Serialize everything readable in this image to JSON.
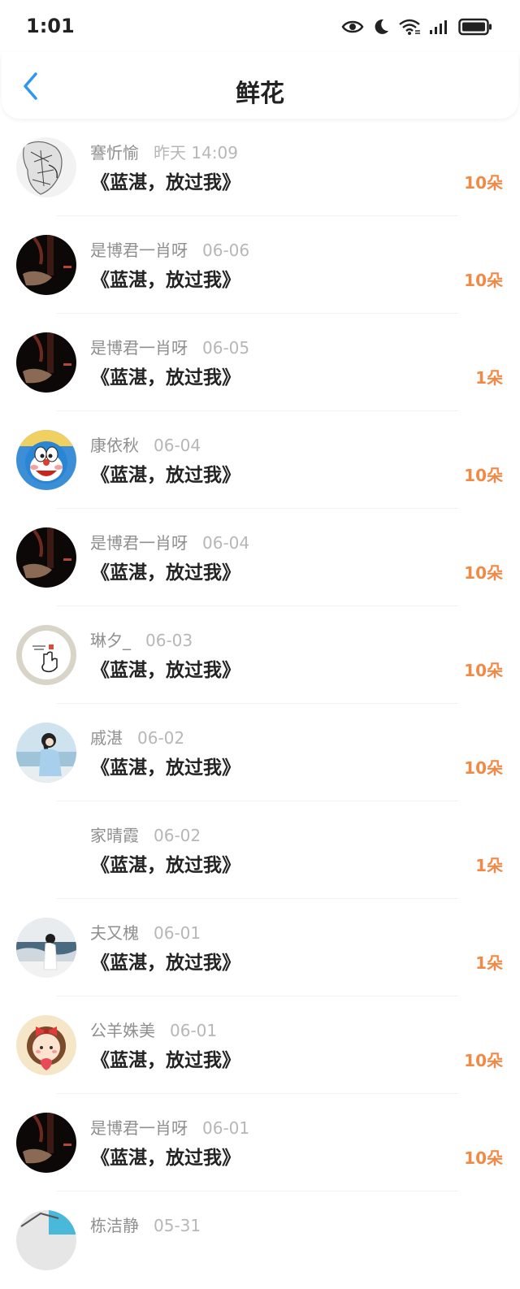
{
  "status_bar": {
    "time": "1:01",
    "icons": [
      "eye-icon",
      "moon-icon",
      "wifi-icon",
      "signal-icon",
      "battery-icon"
    ]
  },
  "header": {
    "back_icon": "chevron-left-icon",
    "title": "鲜花"
  },
  "colors": {
    "accent_blue": "#2f97f1",
    "flower_orange": "#f08a46",
    "name_gray": "#8f8f8f",
    "time_gray": "#b7b7b7"
  },
  "items": [
    {
      "name": "謇忻愉",
      "time": "昨天 14:09",
      "book": "《蓝湛，放过我》",
      "count": "10朵",
      "avatar": "sketch"
    },
    {
      "name": "是博君一肖呀",
      "time": "06-06",
      "book": "《蓝湛，放过我》",
      "count": "10朵",
      "avatar": "dark"
    },
    {
      "name": "是博君一肖呀",
      "time": "06-05",
      "book": "《蓝湛，放过我》",
      "count": "1朵",
      "avatar": "dark"
    },
    {
      "name": "康依秋",
      "time": "06-04",
      "book": "《蓝湛，放过我》",
      "count": "10朵",
      "avatar": "doraemon"
    },
    {
      "name": "是博君一肖呀",
      "time": "06-04",
      "book": "《蓝湛，放过我》",
      "count": "10朵",
      "avatar": "dark"
    },
    {
      "name": "琳夕_",
      "time": "06-03",
      "book": "《蓝湛，放过我》",
      "count": "10朵",
      "avatar": "hand"
    },
    {
      "name": "戚湛",
      "time": "06-02",
      "book": "《蓝湛，放过我》",
      "count": "10朵",
      "avatar": "sea-girl"
    },
    {
      "name": "家晴霞",
      "time": "06-02",
      "book": "《蓝湛，放过我》",
      "count": "1朵",
      "avatar": "blank"
    },
    {
      "name": "夫又槐",
      "time": "06-01",
      "book": "《蓝湛，放过我》",
      "count": "1朵",
      "avatar": "sea-girl-white"
    },
    {
      "name": "公羊姝美",
      "time": "06-01",
      "book": "《蓝湛，放过我》",
      "count": "10朵",
      "avatar": "cartoon-girl"
    },
    {
      "name": "是博君一肖呀",
      "time": "06-01",
      "book": "《蓝湛，放过我》",
      "count": "10朵",
      "avatar": "dark"
    },
    {
      "name": "栋洁静",
      "time": "05-31",
      "book": "",
      "count": "",
      "avatar": "photo"
    }
  ]
}
